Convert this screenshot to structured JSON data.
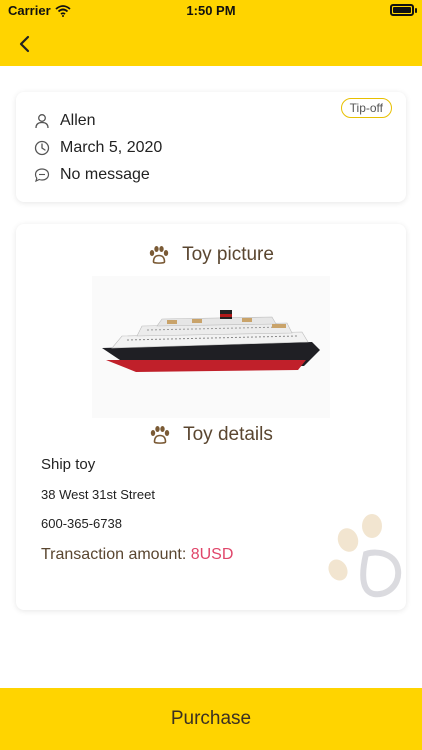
{
  "status_bar": {
    "carrier": "Carrier",
    "time": "1:50 PM"
  },
  "colors": {
    "accent": "#FFD400",
    "amount": "#E0466A",
    "heading": "#5a4630"
  },
  "info_card": {
    "badge": "Tip-off",
    "user": "Allen",
    "date": "March 5, 2020",
    "message": "No message"
  },
  "toy_card": {
    "picture_title": "Toy picture",
    "details_title": "Toy details",
    "name": "Ship toy",
    "address": "38 West 31st Street",
    "phone": "600-365-6738",
    "amount_label": "Transaction amount:",
    "amount_value": "8USD"
  },
  "footer": {
    "purchase_label": "Purchase"
  },
  "icons": [
    "back-chevron-icon",
    "person-icon",
    "clock-icon",
    "message-icon",
    "paw-icon",
    "wifi-icon",
    "battery-icon"
  ]
}
